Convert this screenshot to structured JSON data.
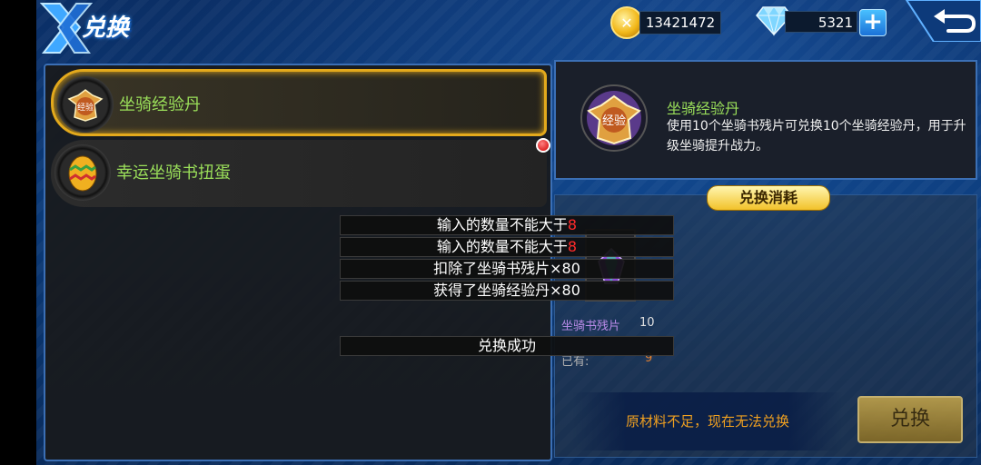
{
  "header": {
    "title": "兑换",
    "gold": "13421472",
    "diamonds": "5321",
    "plus_label": "+"
  },
  "list": {
    "items": [
      {
        "label": "坐骑经验丹",
        "icon_text": "经验"
      },
      {
        "label": "幸运坐骑书扭蛋"
      }
    ]
  },
  "detail": {
    "name": "坐骑经验丹",
    "desc": "使用10个坐骑书残片可兑换10个坐骑经验丹，用于升级坐骑提升战力。",
    "icon_text": "经验"
  },
  "cost": {
    "tab_label": "兑换消耗",
    "material_name": "坐骑书残片",
    "material_count": "10",
    "own_label": "已有:",
    "own_value": "9",
    "warning": "原材料不足，现在无法兑换",
    "button_label": "兑换"
  },
  "toasts": [
    {
      "text": "输入的数量不能大于",
      "num": "8"
    },
    {
      "text": "输入的数量不能大于",
      "num": "8"
    },
    {
      "text": "扣除了坐骑书残片×80",
      "num": ""
    },
    {
      "text": "获得了坐骑经验丹×80",
      "num": ""
    },
    {
      "text": "兑换成功",
      "num": ""
    }
  ],
  "colors": {
    "accent_gold": "#e3a91c",
    "item_label_green": "#9be05a",
    "warning_orange": "#f0a020"
  },
  "icons": [
    "logo-x-icon",
    "gold-coin-icon",
    "diamond-icon",
    "plus-icon",
    "back-arrow-icon",
    "exp-badge-icon",
    "egg-icon",
    "crystal-icon",
    "red-dot-icon"
  ]
}
